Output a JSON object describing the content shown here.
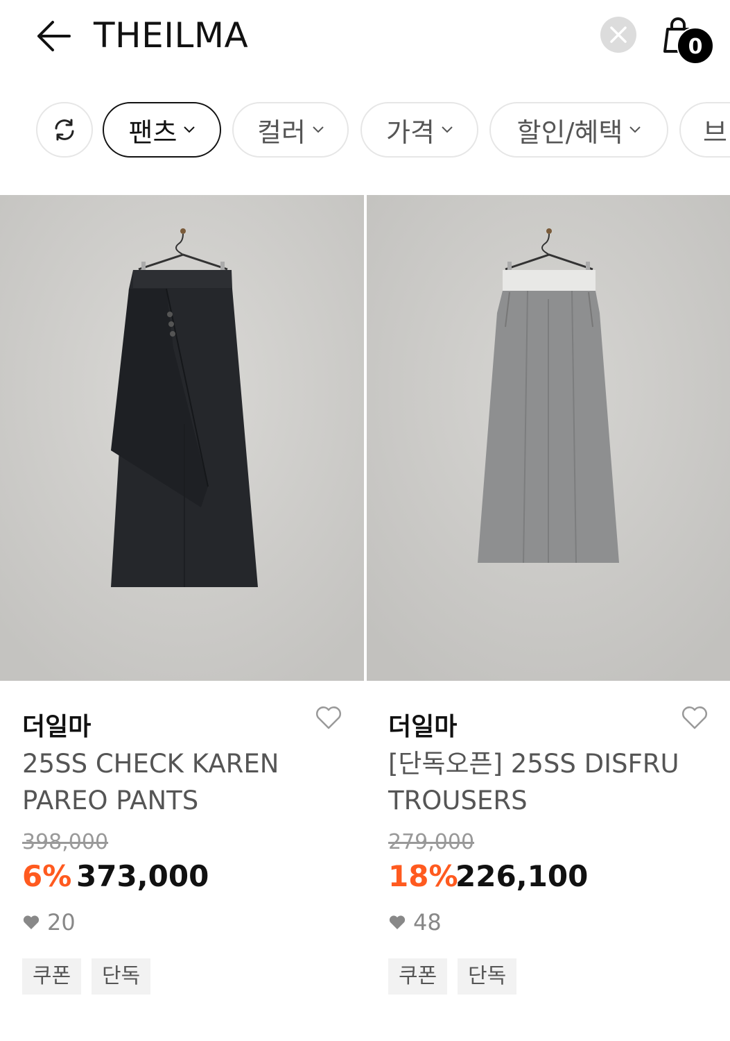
{
  "header": {
    "title": "THEILMA",
    "cart_count": "0"
  },
  "filters": {
    "items": [
      {
        "label": "팬츠",
        "active": true
      },
      {
        "label": "컬러",
        "active": false
      },
      {
        "label": "가격",
        "active": false
      },
      {
        "label": "할인/혜택",
        "active": false
      },
      {
        "label": "브",
        "active": false
      }
    ]
  },
  "products": [
    {
      "brand": "더일마",
      "name": "25SS CHECK KAREN PAREO PANTS",
      "original_price": "398,000",
      "discount": "6%",
      "price": "373,000",
      "likes": "20",
      "tags": [
        "쿠폰",
        "단독"
      ]
    },
    {
      "brand": "더일마",
      "name": "[단독오픈] 25SS DISFRU TROUSERS",
      "original_price": "279,000",
      "discount": "18%",
      "price": "226,100",
      "likes": "48",
      "tags": [
        "쿠폰",
        "단독"
      ]
    }
  ],
  "colors": {
    "discount": "#ff5a1f",
    "active_chip_border": "#111111",
    "tag_bg": "#f2f2f2"
  }
}
